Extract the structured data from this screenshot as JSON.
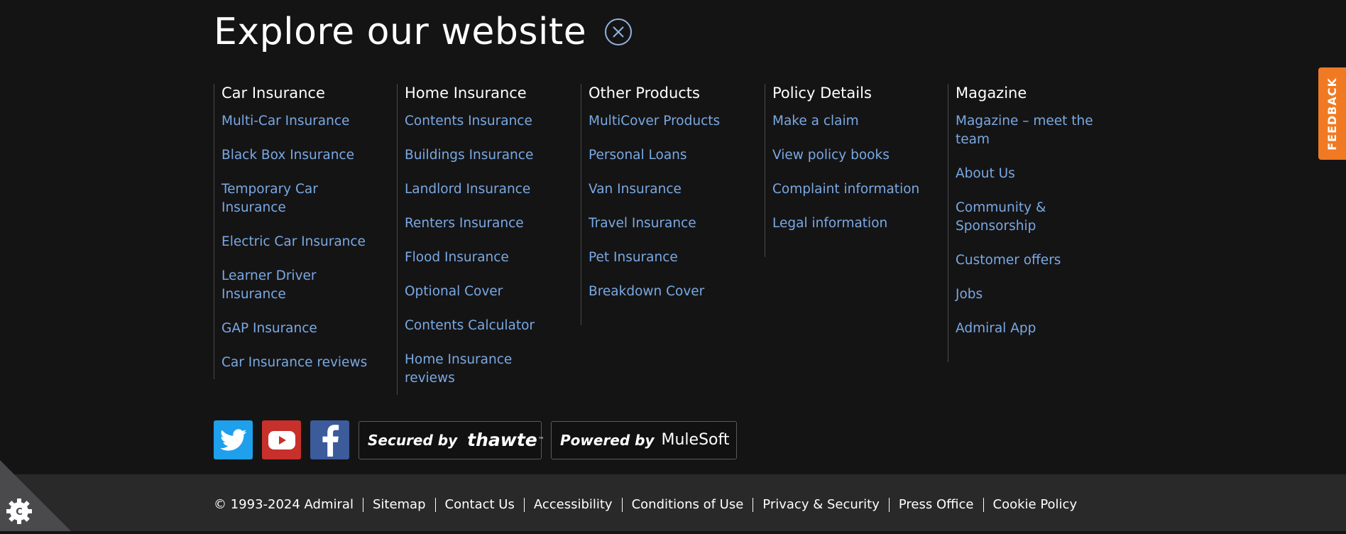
{
  "title": "Explore our website",
  "columns": [
    {
      "heading": "Car Insurance",
      "links": [
        "Multi-Car Insurance",
        "Black Box Insurance",
        "Temporary Car Insurance",
        "Electric Car Insurance",
        "Learner Driver Insurance",
        "GAP Insurance",
        "Car Insurance reviews"
      ]
    },
    {
      "heading": "Home Insurance",
      "links": [
        "Contents Insurance",
        "Buildings Insurance",
        "Landlord Insurance",
        "Renters Insurance",
        "Flood Insurance",
        "Optional Cover",
        "Contents Calculator",
        "Home Insurance reviews"
      ]
    },
    {
      "heading": "Other Products",
      "links": [
        "MultiCover Products",
        "Personal Loans",
        "Van Insurance",
        "Travel Insurance",
        "Pet Insurance",
        "Breakdown Cover"
      ]
    },
    {
      "heading": "Policy Details",
      "links": [
        "Make a claim",
        "View policy books",
        "Complaint information",
        "Legal information"
      ]
    },
    {
      "heading": "Magazine",
      "links": [
        "Magazine – meet the team",
        "About Us",
        "Community & Sponsorship",
        "Customer offers",
        "Jobs",
        "Admiral App"
      ]
    }
  ],
  "badges": {
    "secured_label": "Secured by",
    "thawte_brand": "thawte",
    "powered_label": "Powered by",
    "mulesoft_brand": "MuleSoft"
  },
  "social_icons": [
    "twitter-icon",
    "youtube-icon",
    "facebook-icon"
  ],
  "legal": {
    "copyright": "© 1993-2024 Admiral",
    "links": [
      "Sitemap",
      "Contact Us",
      "Accessibility",
      "Conditions of Use",
      "Privacy & Security",
      "Press Office",
      "Cookie Policy"
    ]
  },
  "feedback_label": "FEEDBACK",
  "colors": {
    "background": "#151415",
    "footer_bar": "#2a292a",
    "link": "#79a9e3",
    "feedback": "#f07a23"
  }
}
